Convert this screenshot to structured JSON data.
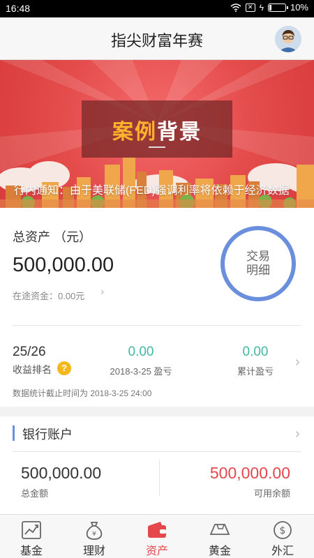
{
  "status_bar": {
    "time": "16:48",
    "battery": "10%"
  },
  "header": {
    "title": "指尖财富年赛"
  },
  "banner": {
    "title_part1": "案例",
    "title_part2": "背景",
    "ticker": "行内通知：由于美联储(FED)强调利率将依赖于经济数据"
  },
  "assets": {
    "label": "总资产 （元）",
    "amount": "500,000.00",
    "in_transit": "在途资金：0.00元",
    "trade_detail": [
      "交易",
      "明细"
    ]
  },
  "ranking": {
    "rank_value": "25/26",
    "rank_label": "收益排名",
    "daily_pnl_value": "0.00",
    "daily_pnl_label": "2018-3-25 盈亏",
    "total_pnl_value": "0.00",
    "total_pnl_label": "累计盈亏",
    "stat_note": "数据统计截止时间为 2018-3-25 24:00"
  },
  "bank_account": {
    "title": "银行账户",
    "total_value": "500,000.00",
    "total_label": "总金额",
    "available_value": "500,000.00",
    "available_label": "可用余额"
  },
  "tabs": [
    {
      "label": "基金",
      "icon": "chart-icon"
    },
    {
      "label": "理财",
      "icon": "money-bag-icon"
    },
    {
      "label": "资产",
      "icon": "wallet-icon",
      "active": true
    },
    {
      "label": "黄金",
      "icon": "gold-bar-icon"
    },
    {
      "label": "外汇",
      "icon": "dollar-icon"
    }
  ],
  "colors": {
    "accent_blue": "#6a8fdd",
    "profit_green": "#43b9a4",
    "highlight_red": "#e6474d",
    "help_yellow": "#f3b81e"
  }
}
